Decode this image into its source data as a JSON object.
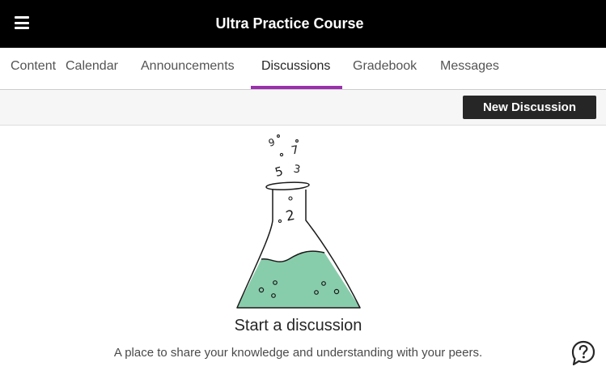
{
  "header": {
    "title": "Ultra Practice Course",
    "menu_icon": "hamburger-menu-icon"
  },
  "tabs": [
    {
      "label": "Content",
      "active": false
    },
    {
      "label": "Calendar",
      "active": false
    },
    {
      "label": "Announcements",
      "active": false
    },
    {
      "label": "Discussions",
      "active": true
    },
    {
      "label": "Gradebook",
      "active": false
    },
    {
      "label": "Messages",
      "active": false
    }
  ],
  "toolbar": {
    "new_discussion_label": "New Discussion"
  },
  "empty_state": {
    "illustration": "flask-icon",
    "title": "Start a discussion",
    "subtitle": "A place to share your knowledge and understanding with your peers."
  },
  "help": {
    "icon": "help-question-icon"
  },
  "colors": {
    "topbar": "#000000",
    "active_tab_underline": "#9b2fae",
    "button": "#262626",
    "flask_liquid": "#88cdab"
  }
}
